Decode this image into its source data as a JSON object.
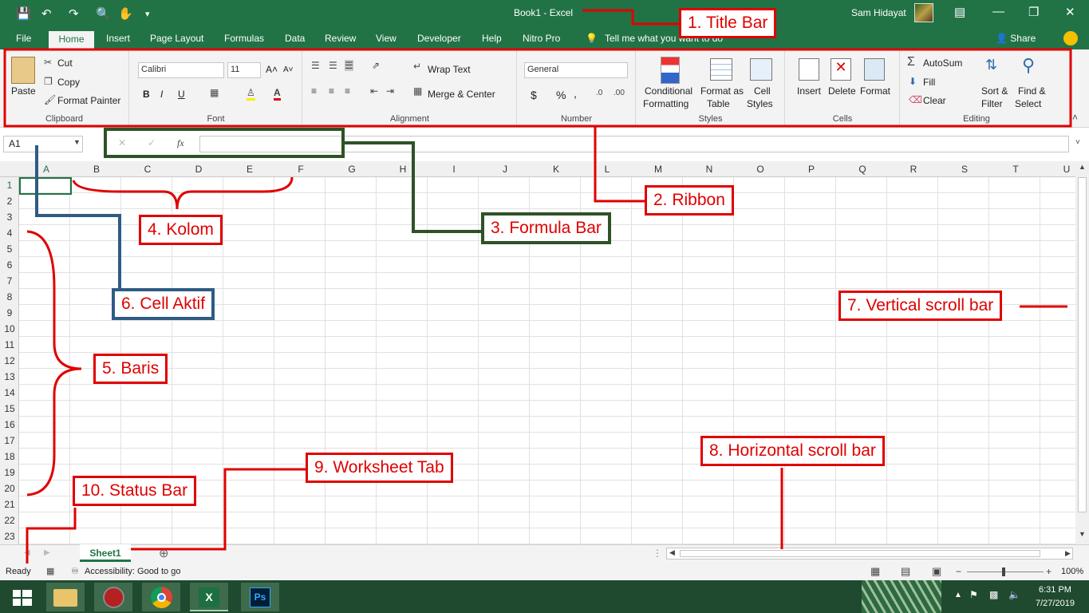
{
  "titlebar": {
    "title": "Book1  -  Excel",
    "user": "Sam Hidayat"
  },
  "tabs": [
    "File",
    "Home",
    "Insert",
    "Page Layout",
    "Formulas",
    "Data",
    "Review",
    "View",
    "Developer",
    "Help",
    "Nitro Pro"
  ],
  "tell_me": "Tell me what you want to do",
  "share": "Share",
  "clipboard": {
    "paste": "Paste",
    "cut": "Cut",
    "copy": "Copy",
    "format_painter": "Format Painter",
    "label": "Clipboard"
  },
  "font": {
    "name": "Calibri",
    "size": "11",
    "bold": "B",
    "italic": "I",
    "underline": "U",
    "label": "Font"
  },
  "alignment": {
    "wrap": "Wrap Text",
    "merge": "Merge & Center",
    "label": "Alignment"
  },
  "number": {
    "format": "General",
    "currency": "$",
    "percent": "%",
    "comma": ",",
    "label": "Number"
  },
  "styles": {
    "cond": "Conditional",
    "cond2": "Formatting",
    "fmt_table": "Format as",
    "fmt_table2": "Table",
    "cell_styles": "Cell",
    "cell_styles2": "Styles",
    "label": "Styles"
  },
  "cells": {
    "insert": "Insert",
    "delete": "Delete",
    "format": "Format",
    "label": "Cells"
  },
  "editing": {
    "autosum": "AutoSum",
    "fill": "Fill",
    "clear": "Clear",
    "sort": "Sort &",
    "sort2": "Filter",
    "find": "Find &",
    "find2": "Select",
    "label": "Editing"
  },
  "formula_bar": {
    "name_box": "A1",
    "fx": "fx",
    "value": ""
  },
  "columns": [
    "A",
    "B",
    "C",
    "D",
    "E",
    "F",
    "G",
    "H",
    "I",
    "J",
    "K",
    "L",
    "M",
    "N",
    "O",
    "P",
    "Q",
    "R",
    "S",
    "T",
    "U"
  ],
  "rows": [
    "1",
    "2",
    "3",
    "4",
    "5",
    "6",
    "7",
    "8",
    "9",
    "10",
    "11",
    "12",
    "13",
    "14",
    "15",
    "16",
    "17",
    "18",
    "19",
    "20",
    "21",
    "22",
    "23"
  ],
  "sheet_tab": "Sheet1",
  "status": {
    "ready": "Ready",
    "accessibility": "Accessibility: Good to go",
    "zoom": "100%"
  },
  "clock": {
    "time": "6:31 PM",
    "date": "7/27/2019"
  },
  "annotations": {
    "title_bar": "1. Title Bar",
    "ribbon": "2. Ribbon",
    "formula_bar": "3. Formula Bar",
    "kolom": "4. Kolom",
    "baris": "5. Baris",
    "cell_aktif": "6. Cell Aktif",
    "vertical_scroll": "7. Vertical scroll bar",
    "horizontal_scroll": "8. Horizontal  scroll bar",
    "worksheet_tab": "9. Worksheet Tab",
    "status_bar": "10. Status Bar"
  },
  "colors": {
    "excel_green": "#217346",
    "annotation_red": "#e00000",
    "annotation_green": "#2e5226",
    "annotation_blue": "#2f5b85"
  },
  "icons": [
    "save-icon",
    "undo-icon",
    "redo-icon",
    "print-preview-icon",
    "customize-icon",
    "minimize-icon",
    "restore-icon",
    "close-icon",
    "lightbulb-icon",
    "share-icon",
    "smiley-icon",
    "windows-start-icon",
    "file-explorer-icon",
    "chrome-icon",
    "excel-icon",
    "photoshop-icon"
  ]
}
